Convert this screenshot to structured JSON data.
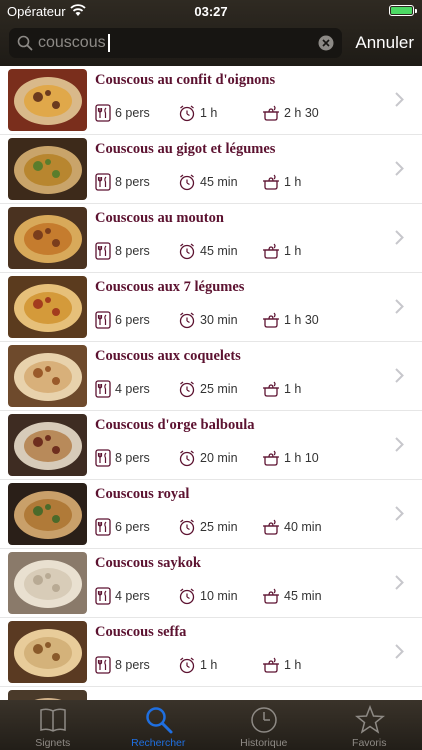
{
  "status_bar": {
    "carrier": "Opérateur",
    "time": "03:27"
  },
  "search": {
    "query": "couscous",
    "cancel_label": "Annuler"
  },
  "accent_color": "#5c1230",
  "recipes": [
    {
      "title": "Couscous au confit d'oignons",
      "persons": "6 pers",
      "prep": "1 h",
      "cook": "2 h 30"
    },
    {
      "title": "Couscous au gigot et légumes",
      "persons": "8 pers",
      "prep": "45 min",
      "cook": "1 h"
    },
    {
      "title": "Couscous au mouton",
      "persons": "8 pers",
      "prep": "45 min",
      "cook": "1 h"
    },
    {
      "title": "Couscous aux 7 légumes",
      "persons": "6 pers",
      "prep": "30 min",
      "cook": "1 h 30"
    },
    {
      "title": "Couscous aux coquelets",
      "persons": "4 pers",
      "prep": "25 min",
      "cook": "1 h"
    },
    {
      "title": "Couscous d'orge balboula",
      "persons": "8 pers",
      "prep": "20 min",
      "cook": "1 h 10"
    },
    {
      "title": "Couscous royal",
      "persons": "6 pers",
      "prep": "25 min",
      "cook": "40 min"
    },
    {
      "title": "Couscous saykok",
      "persons": "4 pers",
      "prep": "10 min",
      "cook": "45 min"
    },
    {
      "title": "Couscous seffa",
      "persons": "8 pers",
      "prep": "1 h",
      "cook": "1 h"
    },
    {
      "title": "",
      "persons": "",
      "prep": "",
      "cook": ""
    }
  ],
  "tabs": [
    {
      "label": "Signets",
      "icon": "book-icon"
    },
    {
      "label": "Rechercher",
      "icon": "search-icon"
    },
    {
      "label": "Historique",
      "icon": "clock-icon"
    },
    {
      "label": "Favoris",
      "icon": "star-icon"
    }
  ],
  "active_tab": "Rechercher"
}
